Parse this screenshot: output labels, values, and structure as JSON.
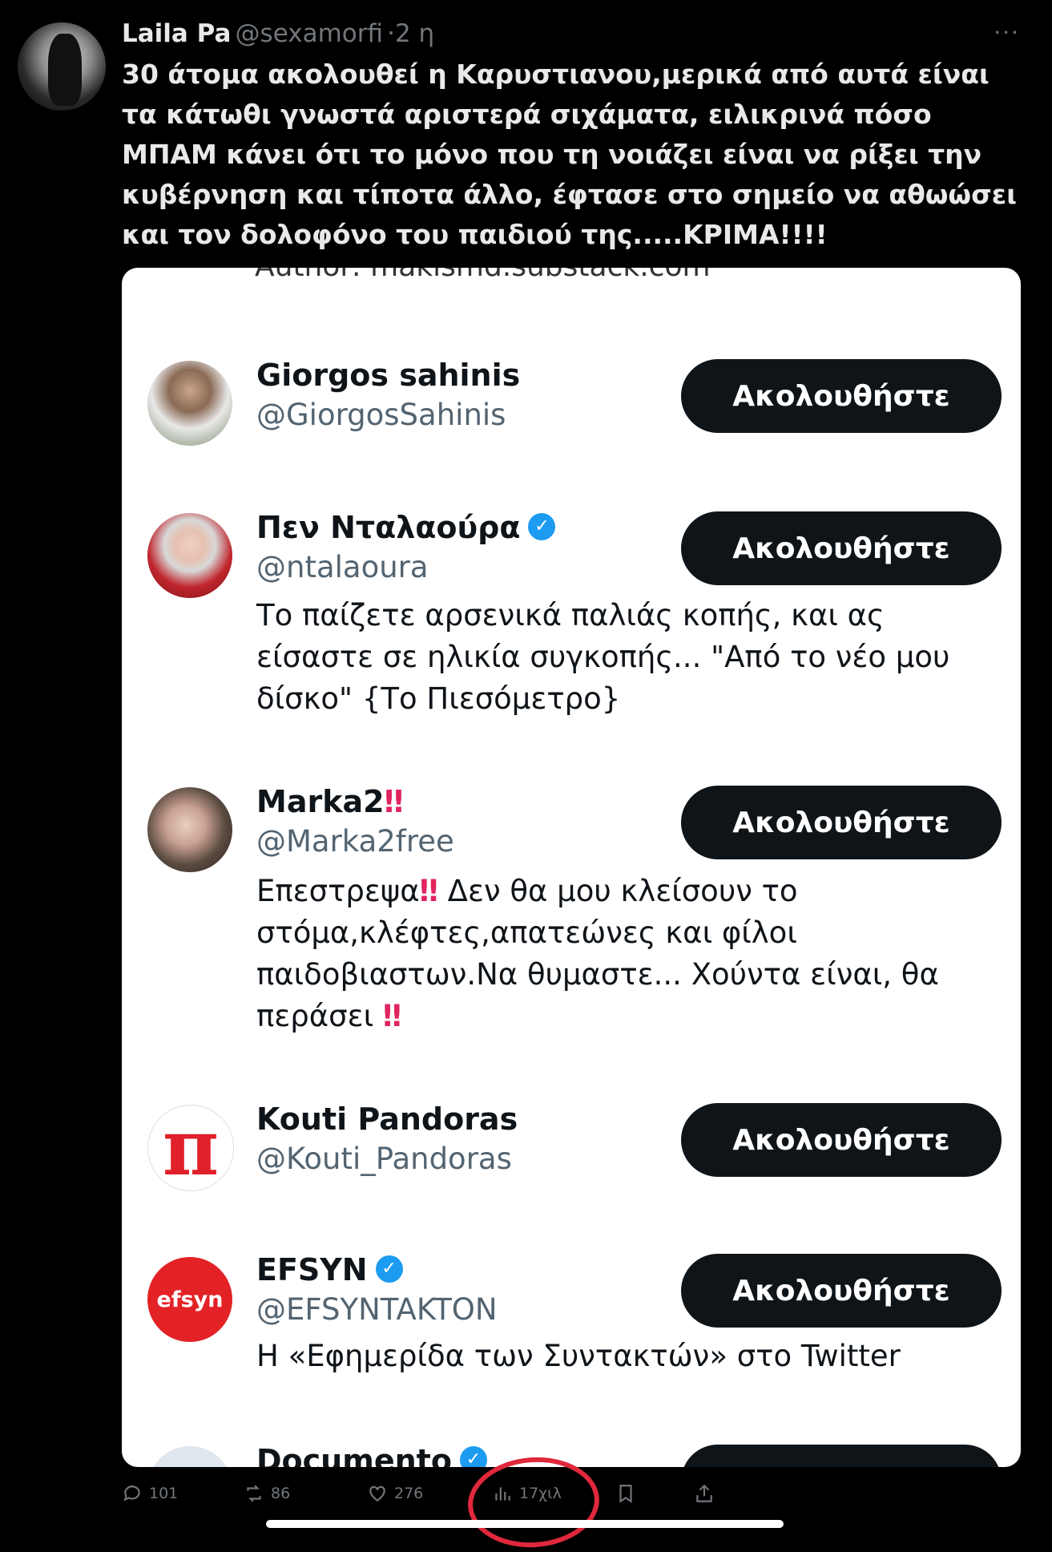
{
  "tweet": {
    "author_name": "Laila Pa",
    "author_handle": "@sexamorfi",
    "separator": "·",
    "time": "2 η",
    "more": "···",
    "text": "30 άτομα ακολουθεί η Καρυστιανου,μερικά από αυτά είναι τα κάτωθι γνωστά αριστερά σιχάματα, ειλικρινά πόσο ΜΠΑΜ κάνει ότι το μόνο που τη νοιάζει είναι να ρίξει την κυβέρνηση και τίποτα άλλο, έφτασε στο σημείο να αθωώσει και τον δολοφόνο του παιδιού της.....ΚΡΙΜΑ!!!!"
  },
  "card": {
    "cut_text": "Author: makismd.substack.com",
    "follow_label": "Ακολουθήστε",
    "users": [
      {
        "name": "Giorgos sahinis",
        "handle": "@GiorgosSahinis",
        "verified": false,
        "bio": ""
      },
      {
        "name": "Πεν Νταλαούρα",
        "handle": "@ntalaoura",
        "verified": true,
        "bio": "Το παίζετε αρσενικά παλιάς κοπής, και ας είσαστε σε ηλικία συγκοπής... \"Από το νέο μου δίσκο\" {Το Πιεσόμετρο}"
      },
      {
        "name": "Marka2",
        "name_suffix": "‼️",
        "handle": "@Marka2free",
        "verified": false,
        "bio_part1": "Επεστρεψα",
        "bio_bang1": "‼",
        "bio_part2": " Δεν θα μου κλείσουν το στόμα,κλέφτες,απατεώνες και φίλοι παιδοβιαστων.Να θυμαστε... Χούντα είναι, θα περάσει ",
        "bio_bang2": "‼"
      },
      {
        "name": "Kouti Pandoras",
        "handle": "@Kouti_Pandoras",
        "verified": false,
        "bio": "",
        "avatar_glyph": "π"
      },
      {
        "name": "EFSYN",
        "handle": "@EFSYNTAKTON",
        "verified": true,
        "bio": "Η «Εφημερίδα των Συντακτών» στο Twitter",
        "avatar_text": "efsyn"
      },
      {
        "name": "Documento",
        "handle": "",
        "verified": true,
        "bio": ""
      }
    ]
  },
  "actions": {
    "replies": "101",
    "retweets": "86",
    "likes": "276",
    "views": "17χιλ"
  },
  "colors": {
    "background": "#000000",
    "verified": "#1d9bf0",
    "button": "#0f1419",
    "annotation": "#e0283c"
  }
}
